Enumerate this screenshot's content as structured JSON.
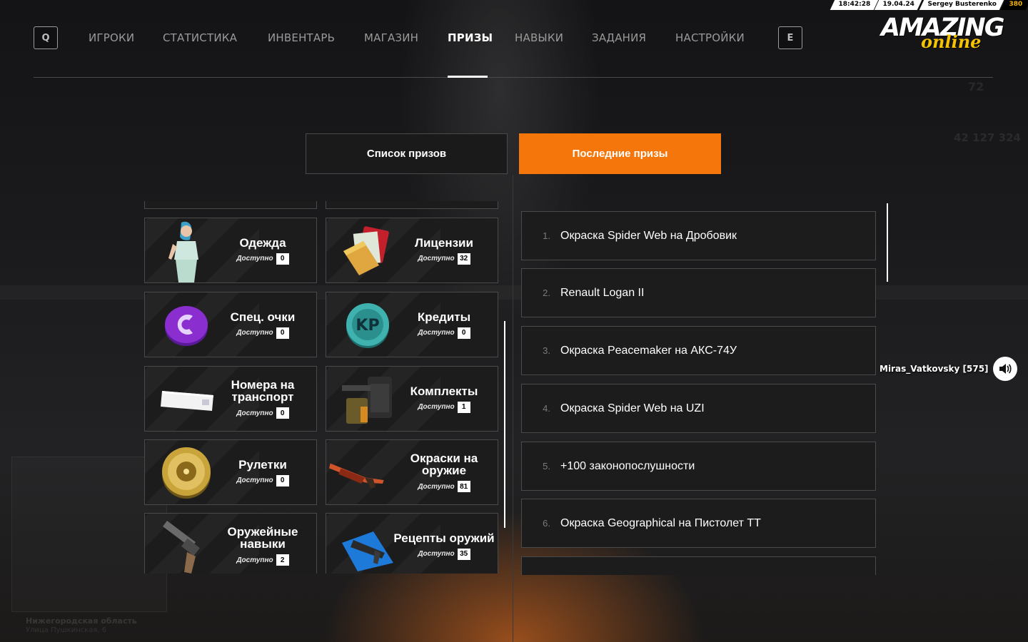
{
  "status_bar": {
    "time": "18:42:28",
    "date": "19.04.24",
    "player": "Sergey Busterenko",
    "level": "380"
  },
  "logo": {
    "line1": "AMAZING",
    "line2": "online"
  },
  "nav": {
    "key_left": "Q",
    "key_right": "E",
    "items": [
      {
        "label": "ИГРОКИ"
      },
      {
        "label": "СТАТИСТИКА"
      },
      {
        "label": "ИНВЕНТАРЬ"
      },
      {
        "label": "МАГАЗИН"
      },
      {
        "label": "ПРИЗЫ"
      },
      {
        "label": "НАВЫКИ"
      },
      {
        "label": "ЗАДАНИЯ"
      },
      {
        "label": "НАСТРОЙКИ"
      }
    ],
    "active": "ПРИЗЫ"
  },
  "tabs": {
    "list": "Список призов",
    "last": "Последние призы"
  },
  "available_label": "Доступно",
  "categories": [
    {
      "title": "Одежда",
      "count": "0",
      "icon": "clothing-icon"
    },
    {
      "title": "Лицензии",
      "count": "32",
      "icon": "license-icon"
    },
    {
      "title": "Спец. очки",
      "count": "0",
      "icon": "special-points-icon"
    },
    {
      "title": "Кредиты",
      "count": "0",
      "icon": "credits-icon"
    },
    {
      "title": "Номера на транспорт",
      "count": "0",
      "icon": "license-plate-icon"
    },
    {
      "title": "Комплекты",
      "count": "1",
      "icon": "kit-icon"
    },
    {
      "title": "Рулетки",
      "count": "0",
      "icon": "roulette-icon"
    },
    {
      "title": "Окраски на оружие",
      "count": "81",
      "icon": "weapon-skin-icon"
    },
    {
      "title": "Оружейные навыки",
      "count": "2",
      "icon": "weapon-skills-icon"
    },
    {
      "title": "Рецепты оружий",
      "count": "35",
      "icon": "weapon-recipe-icon"
    }
  ],
  "recent_prizes": [
    {
      "num": "1.",
      "name": "Окраска Spider Web на Дробовик"
    },
    {
      "num": "2.",
      "name": "Renault Logan II"
    },
    {
      "num": "3.",
      "name": "Окраска Peacemaker на АКС-74У"
    },
    {
      "num": "4.",
      "name": "Окраска Spider Web на UZI"
    },
    {
      "num": "5.",
      "name": "+100 законопослушности"
    },
    {
      "num": "6.",
      "name": "Окраска Geographical на Пистолет ТТ"
    }
  ],
  "voice": {
    "name": "Miras_Vatkovsky [575]",
    "icon": "speaker-icon"
  },
  "background": {
    "region": "Нижегородская область",
    "street": "Улица Пушкинская, 6",
    "hud_number": "72",
    "money": "42 127 324"
  },
  "colors": {
    "accent": "#f5760a",
    "card_bg": "#1c1c1d",
    "border": "#4a4a4a"
  }
}
